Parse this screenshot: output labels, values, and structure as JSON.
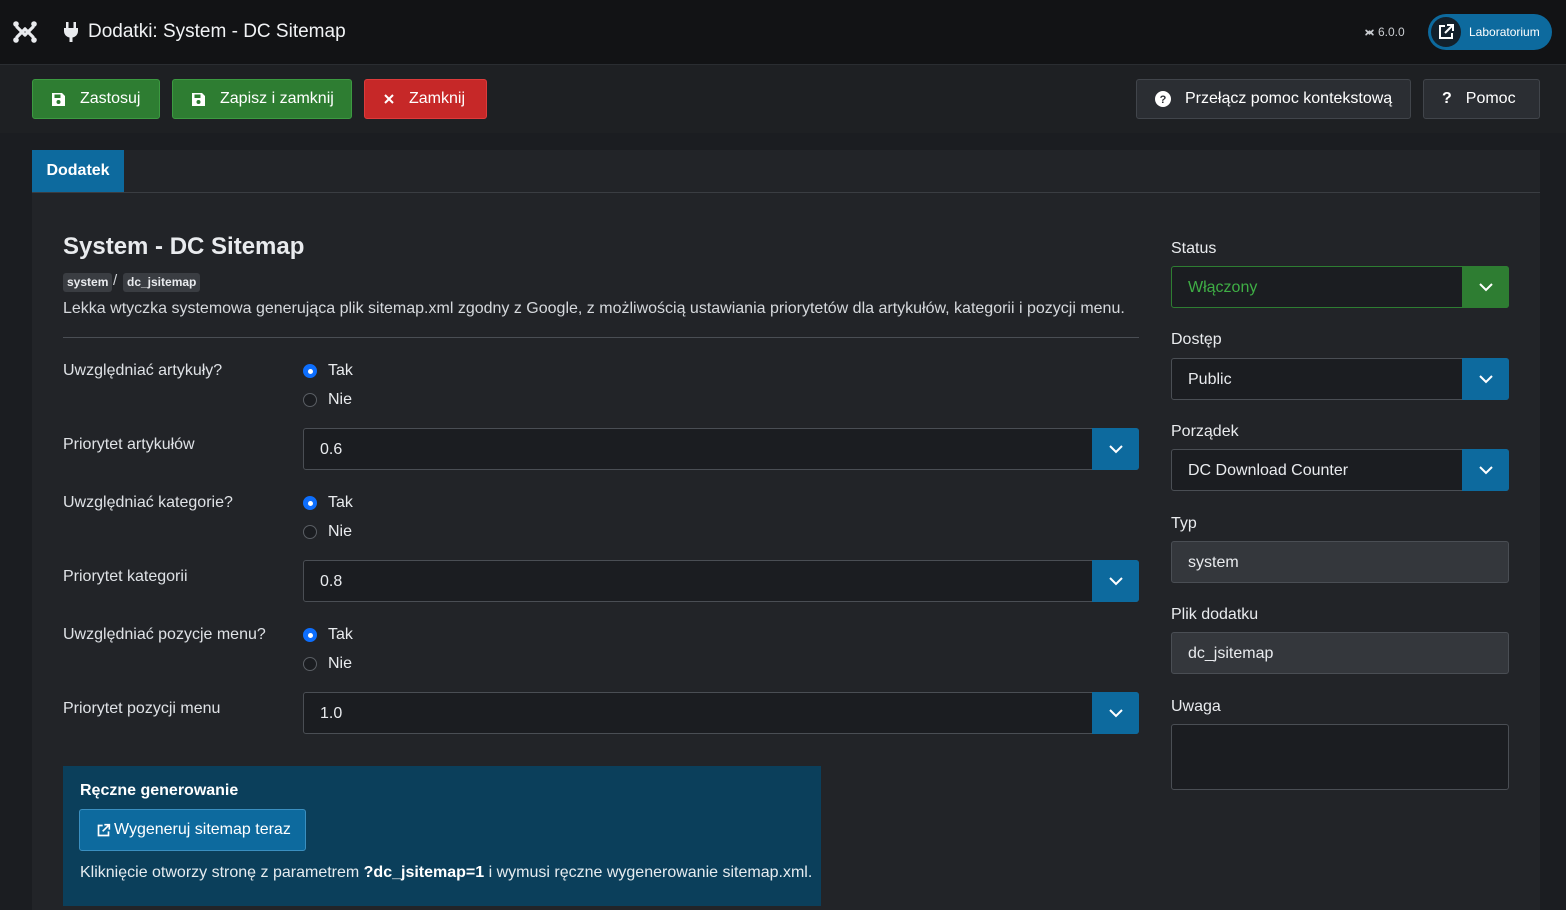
{
  "header": {
    "title": "Dodatki: System - DC Sitemap",
    "version": "6.0.0",
    "site_button": "Laboratorium",
    "icons": [
      "joomla-logo-icon",
      "plug-icon",
      "external-link-icon"
    ]
  },
  "toolbar": {
    "apply": "Zastosuj",
    "save_close": "Zapisz i zamknij",
    "close": "Zamknij",
    "context_help": "Przełącz pomoc kontekstową",
    "help": "Pomoc",
    "help_mark": "?"
  },
  "tabs": [
    "Dodatek"
  ],
  "plugin": {
    "title": "System - DC Sitemap",
    "badge_group": "system",
    "slash": "/",
    "badge_element": "dc_jsitemap",
    "description": "Lekka wtyczka systemowa generująca plik sitemap.xml zgodny z Google, z możliwością ustawiania priorytetów dla artykułów, kategorii i pozycji menu."
  },
  "fields": {
    "include_articles": {
      "label": "Uwzględniać artykuły?",
      "options": [
        "Tak",
        "Nie"
      ],
      "selected": "Tak"
    },
    "articles_priority": {
      "label": "Priorytet artykułów",
      "value": "0.6"
    },
    "include_categories": {
      "label": "Uwzględniać kategorie?",
      "options": [
        "Tak",
        "Nie"
      ],
      "selected": "Tak"
    },
    "categories_priority": {
      "label": "Priorytet kategorii",
      "value": "0.8"
    },
    "include_menu": {
      "label": "Uwzględniać pozycje menu?",
      "options": [
        "Tak",
        "Nie"
      ],
      "selected": "Tak"
    },
    "menu_priority": {
      "label": "Priorytet pozycji menu",
      "value": "1.0"
    }
  },
  "manual": {
    "title": "Ręczne generowanie",
    "button": "Wygeneruj sitemap teraz",
    "note_before": "Kliknięcie otworzy stronę z parametrem ",
    "note_param": "?dc_jsitemap=1",
    "note_after": " i wymusi ręczne wygenerowanie sitemap.xml."
  },
  "sidebar": {
    "status": {
      "label": "Status",
      "value": "Włączony"
    },
    "access": {
      "label": "Dostęp",
      "value": "Public"
    },
    "ordering": {
      "label": "Porządek",
      "value": "DC Download Counter"
    },
    "type": {
      "label": "Typ",
      "value": "system"
    },
    "plugin_file": {
      "label": "Plik dodatku",
      "value": "dc_jsitemap"
    },
    "note": {
      "label": "Uwaga",
      "value": ""
    }
  },
  "colors": {
    "primary": "#0d6a9e",
    "success": "#2e7d32",
    "danger": "#c62828",
    "background": "#1b1d21"
  }
}
